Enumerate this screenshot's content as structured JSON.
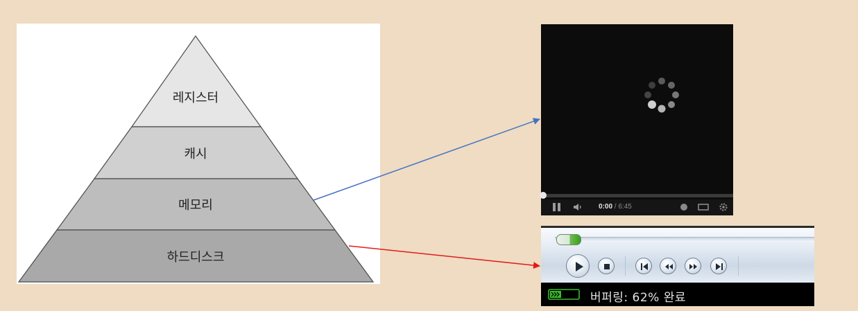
{
  "pyramid": {
    "levels": [
      {
        "label": "레지스터"
      },
      {
        "label": "캐시"
      },
      {
        "label": "메모리"
      },
      {
        "label": "하드디스크"
      }
    ],
    "colors": [
      "#e6e6e6",
      "#d0d0d0",
      "#bdbdbd",
      "#a9a9a9"
    ]
  },
  "arrows": [
    {
      "from": "메모리",
      "to": "video-player",
      "color": "#4472c4"
    },
    {
      "from": "하드디스크",
      "to": "media-player",
      "color": "#e31a1c"
    }
  ],
  "video_player": {
    "time_current": "0:00",
    "time_separator": " / ",
    "time_total": "6:45",
    "progress": 0
  },
  "media_player": {
    "status_text": "버퍼링: 62% 완료",
    "buffer_percent": 62,
    "accent_color": "#3b9d22"
  }
}
